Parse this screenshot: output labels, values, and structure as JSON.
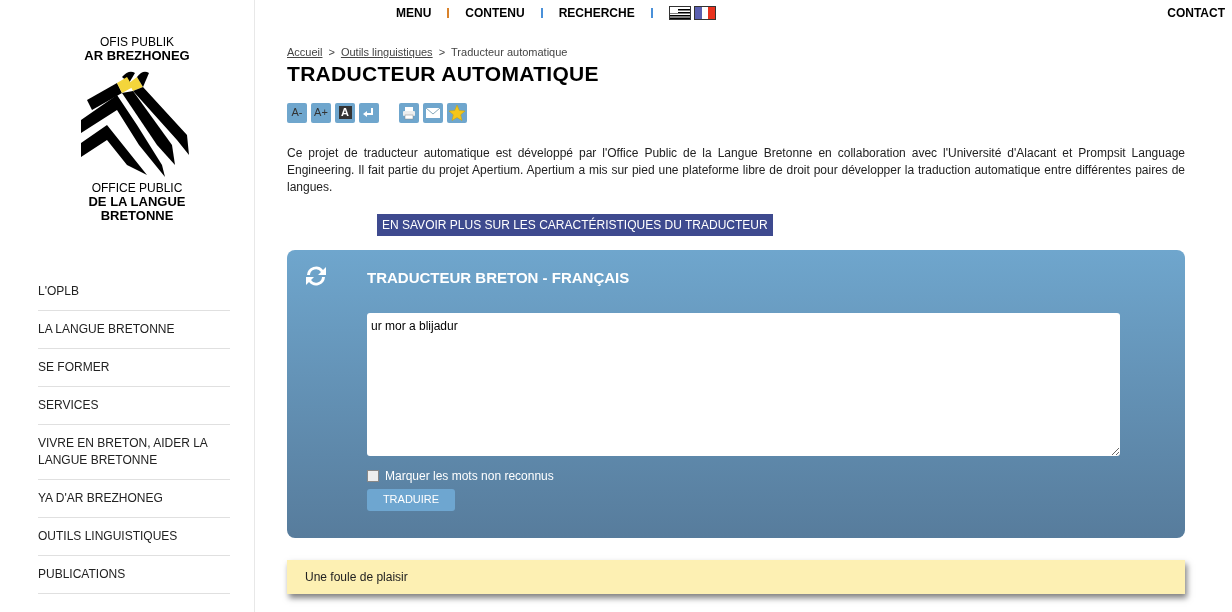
{
  "logo": {
    "line_1": "OFIS PUBLIK",
    "line_2": "AR BREZHONEG",
    "line_3": "OFFICE PUBLIC",
    "line_4": "DE LA LANGUE BRETONNE"
  },
  "top_nav": {
    "items": [
      "MENU",
      "CONTENU",
      "RECHERCHE"
    ],
    "contact": "CONTACT"
  },
  "sidebar": {
    "items": [
      {
        "label": "L'OPLB"
      },
      {
        "label": "LA LANGUE BRETONNE"
      },
      {
        "label": "SE FORMER"
      },
      {
        "label": "SERVICES"
      },
      {
        "label": "VIVRE EN BRETON, AIDER LA LANGUE BRETONNE"
      },
      {
        "label": "YA D'AR BREZHONEG"
      },
      {
        "label": "OUTILS LINGUISTIQUES"
      },
      {
        "label": "PUBLICATIONS"
      }
    ]
  },
  "breadcrumb": [
    {
      "label": "Accueil",
      "link": true
    },
    {
      "label": "Outils linguistiques",
      "link": true
    },
    {
      "label": "Traducteur automatique",
      "link": false
    }
  ],
  "breadcrumb_separator": ">",
  "title": "TRADUCTEUR AUTOMATIQUE",
  "toolbar": [
    {
      "kind": "text",
      "label": "A-"
    },
    {
      "kind": "text",
      "label": "A+"
    },
    {
      "kind": "contrast",
      "label": "A"
    },
    {
      "kind": "return"
    },
    {
      "kind": "gap"
    },
    {
      "kind": "print"
    },
    {
      "kind": "mail"
    },
    {
      "kind": "star"
    }
  ],
  "intro": "Ce projet de traducteur automatique est développé par l'Office Public de la Langue Bretonne en collaboration avec l'Université d'Alacant et Prompsit Language Engineering. Il fait partie du projet Apertium. Apertium a mis sur pied une plateforme libre de droit pour développer la traduction automatique entre différentes paires de langues.",
  "more_button": "EN SAVOIR PLUS SUR LES CARACTÉRISTIQUES DU TRADUCTEUR",
  "translator": {
    "title": "TRADUCTEUR BRETON - FRANÇAIS",
    "input": "ur mor a blijadur",
    "checkbox": {
      "label": "Marquer les mots non reconnus",
      "checked": false
    },
    "button": "TRADUIRE"
  },
  "result": "Une foule de plaisir"
}
